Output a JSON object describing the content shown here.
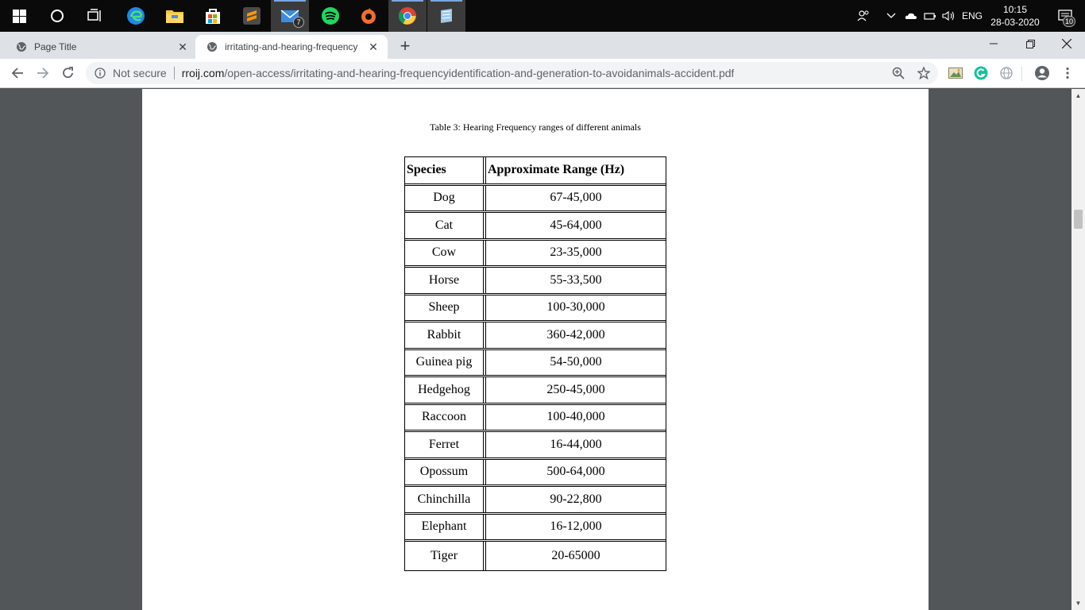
{
  "taskbar": {
    "apps": [
      {
        "name": "start",
        "icon": "windows-logo-icon"
      },
      {
        "name": "search",
        "icon": "cortana-circle-icon"
      },
      {
        "name": "task-view",
        "icon": "task-view-icon"
      },
      {
        "name": "edge",
        "icon": "edge-icon"
      },
      {
        "name": "file-explorer",
        "icon": "folder-icon"
      },
      {
        "name": "store",
        "icon": "store-bag-icon"
      },
      {
        "name": "sublime-text",
        "icon": "sublime-icon"
      },
      {
        "name": "mail",
        "icon": "mail-icon",
        "badge": "7"
      },
      {
        "name": "spotify",
        "icon": "spotify-icon"
      },
      {
        "name": "origin",
        "icon": "origin-icon"
      },
      {
        "name": "chrome",
        "icon": "chrome-icon"
      },
      {
        "name": "notes",
        "icon": "notes-icon"
      }
    ],
    "tray": {
      "language": "ENG",
      "time": "10:15",
      "date": "28-03-2020",
      "notification_count": "10"
    }
  },
  "browser": {
    "tabs": [
      {
        "title": "Page Title",
        "active": false
      },
      {
        "title": "irritating-and-hearing-frequency",
        "active": true
      }
    ],
    "new_tab_label": "+",
    "security_label": "Not secure",
    "url_domain": "rroij.com",
    "url_path": "/open-access/irritating-and-hearing-frequencyidentification-and-generation-to-avoidanimals-accident.pdf"
  },
  "pdf": {
    "caption": "Table 3: Hearing Frequency ranges of different animals",
    "table": {
      "headers": [
        "Species",
        "Approximate Range (Hz)"
      ],
      "rows": [
        [
          "Dog",
          "67-45,000"
        ],
        [
          "Cat",
          "45-64,000"
        ],
        [
          "Cow",
          "23-35,000"
        ],
        [
          "Horse",
          "55-33,500"
        ],
        [
          "Sheep",
          "100-30,000"
        ],
        [
          "Rabbit",
          "360-42,000"
        ],
        [
          "Guinea pig",
          "54-50,000"
        ],
        [
          "Hedgehog",
          "250-45,000"
        ],
        [
          "Raccoon",
          "100-40,000"
        ],
        [
          "Ferret",
          "16-44,000"
        ],
        [
          "Opossum",
          "500-64,000"
        ],
        [
          "Chinchilla",
          "90-22,800"
        ],
        [
          "Elephant",
          "16-12,000"
        ],
        [
          "Tiger",
          "20-65000"
        ]
      ]
    }
  },
  "colors": {
    "taskbar": "#0a0a0a",
    "tabstrip": "#dee1e6",
    "viewer_bg": "#525659",
    "page": "#ffffff"
  }
}
